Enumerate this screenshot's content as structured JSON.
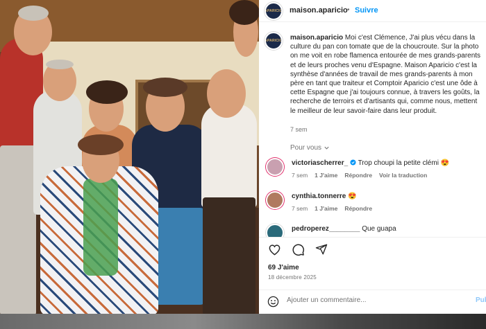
{
  "post": {
    "username": "maison.aparicio",
    "follow_label": "Suivre",
    "separator": "•",
    "avatar_logo_text": "APARICIO",
    "caption": "Moi c'est Clémence, J'ai plus vécu dans la culture du pan con tomate que de la choucroute. Sur la photo on me voit en robe flamenca entourée de mes grands-parents et de leurs proches venu d'Espagne. Maison Aparicio c'est la synthèse d'années de travail de mes grands-parents à mon père en tant que traiteur et Comptoir Aparicio c'est une ôde à cette Espagne que j'ai toujours connue, à travers les goûts, la recherche de terroirs et d'artisants qui, comme nous, mettent le meilleur de leur savoir-faire dans leur produit.",
    "caption_time": "7 sem",
    "show_more": "Pour vous",
    "likes": "69 J'aime",
    "date": "18 décembre 2025",
    "add_comment_placeholder": "Ajouter un commentaire...",
    "publish_label": "Pub"
  },
  "comments": [
    {
      "username": "victoriascherrer_",
      "verified": true,
      "text": "Trop choupi la petite clémi",
      "emoji": "😍",
      "time": "7 sem",
      "likes": "1 J'aime",
      "reply": "Répondre",
      "translate": "Voir la traduction",
      "avatar_color": "#c9a0b0"
    },
    {
      "username": "cynthia.tonnerre",
      "verified": false,
      "text": "",
      "emoji": "😍",
      "time": "7 sem",
      "likes": "1 J'aime",
      "reply": "Répondre",
      "translate": "",
      "avatar_color": "#b07a60"
    },
    {
      "username": "pedroperez________",
      "verified": false,
      "text": "Que guapa",
      "emoji": "",
      "time": "",
      "likes": "",
      "reply": "",
      "translate": "",
      "avatar_color": "#2a6a7a"
    }
  ],
  "icons": {
    "like": "heart-icon",
    "comment": "comment-icon",
    "share": "share-icon",
    "emoji": "smiley-icon",
    "verified": "verified-badge-icon",
    "chevron": "chevron-down-icon"
  },
  "colors": {
    "accent": "#0095f6",
    "text": "#262626",
    "muted": "#737373",
    "verified": "#0095f6"
  }
}
